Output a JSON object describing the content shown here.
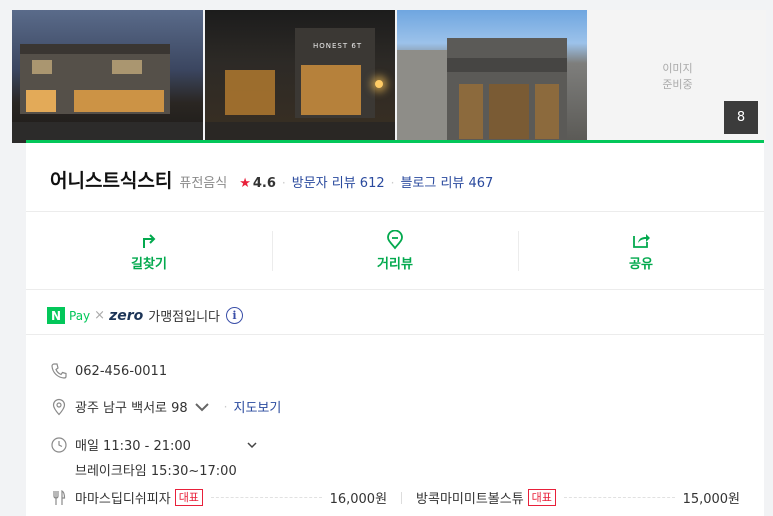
{
  "gallery": {
    "placeholder_line1": "이미지",
    "placeholder_line2": "준비중",
    "photo_count": "8",
    "sign_text": "HONEST 6T"
  },
  "place": {
    "name": "어니스트식스티",
    "category": "퓨전음식",
    "rating": "4.6",
    "visitor_reviews": "방문자 리뷰 612",
    "blog_reviews": "블로그 리뷰 467"
  },
  "actions": [
    {
      "label": "길찾기",
      "icon": "directions-icon"
    },
    {
      "label": "거리뷰",
      "icon": "street-view-icon"
    },
    {
      "label": "공유",
      "icon": "share-icon"
    }
  ],
  "pay": {
    "n_logo": "N",
    "pay_word": "Pay",
    "times": "×",
    "zero_word": "zero",
    "text": "가맹점입니다",
    "info": "i"
  },
  "info": {
    "phone": "062-456-0011",
    "address": "광주 남구 백서로 98",
    "map_link": "지도보기",
    "hours": "매일 11:30 - 21:00",
    "break_time": "브레이크타임 15:30~17:00"
  },
  "menu": [
    {
      "name": "마마스딥디쉬피자",
      "tag": "대표",
      "price": "16,000원"
    },
    {
      "name": "방콕마미미트볼스튜",
      "tag": "대표",
      "price": "15,000원"
    }
  ],
  "colors": {
    "brand_green": "#03c75a",
    "link_blue": "#2a4a9e",
    "star_red": "#e8203a"
  }
}
